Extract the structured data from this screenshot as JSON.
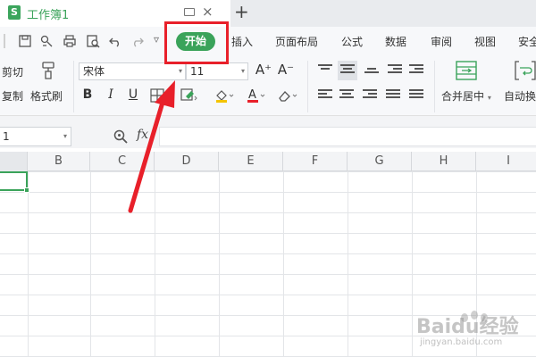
{
  "tab": {
    "title": "工作簿1",
    "logo_letter": "S",
    "close_glyph": "×",
    "new_tab_glyph": "+"
  },
  "menu": {
    "items": [
      "插入",
      "页面布局",
      "公式",
      "数据",
      "审阅",
      "视图",
      "安全"
    ],
    "active": "开始",
    "more_glyph": "▿"
  },
  "ribbon": {
    "cut_label": "剪切",
    "copy_label": "复制",
    "format_painter_label": "格式刷",
    "font_name": "宋体",
    "font_size": "11",
    "bold": "B",
    "italic": "I",
    "underline": "U",
    "grow_font": "A⁺",
    "shrink_font": "A⁻",
    "merge_center_label": "合并居中",
    "auto_wrap_label": "自动换",
    "dropdown_glyph": "▾"
  },
  "formula_bar": {
    "name_box": "1",
    "fx": "fx"
  },
  "columns": [
    "B",
    "C",
    "D",
    "E",
    "F",
    "G",
    "H",
    "I"
  ],
  "watermark": {
    "text": "Baidu经验",
    "url": "jingyan.baidu.com"
  },
  "colors": {
    "accent": "#3aa35a",
    "highlight": "#e8202a",
    "arrow": "#e8202a"
  }
}
